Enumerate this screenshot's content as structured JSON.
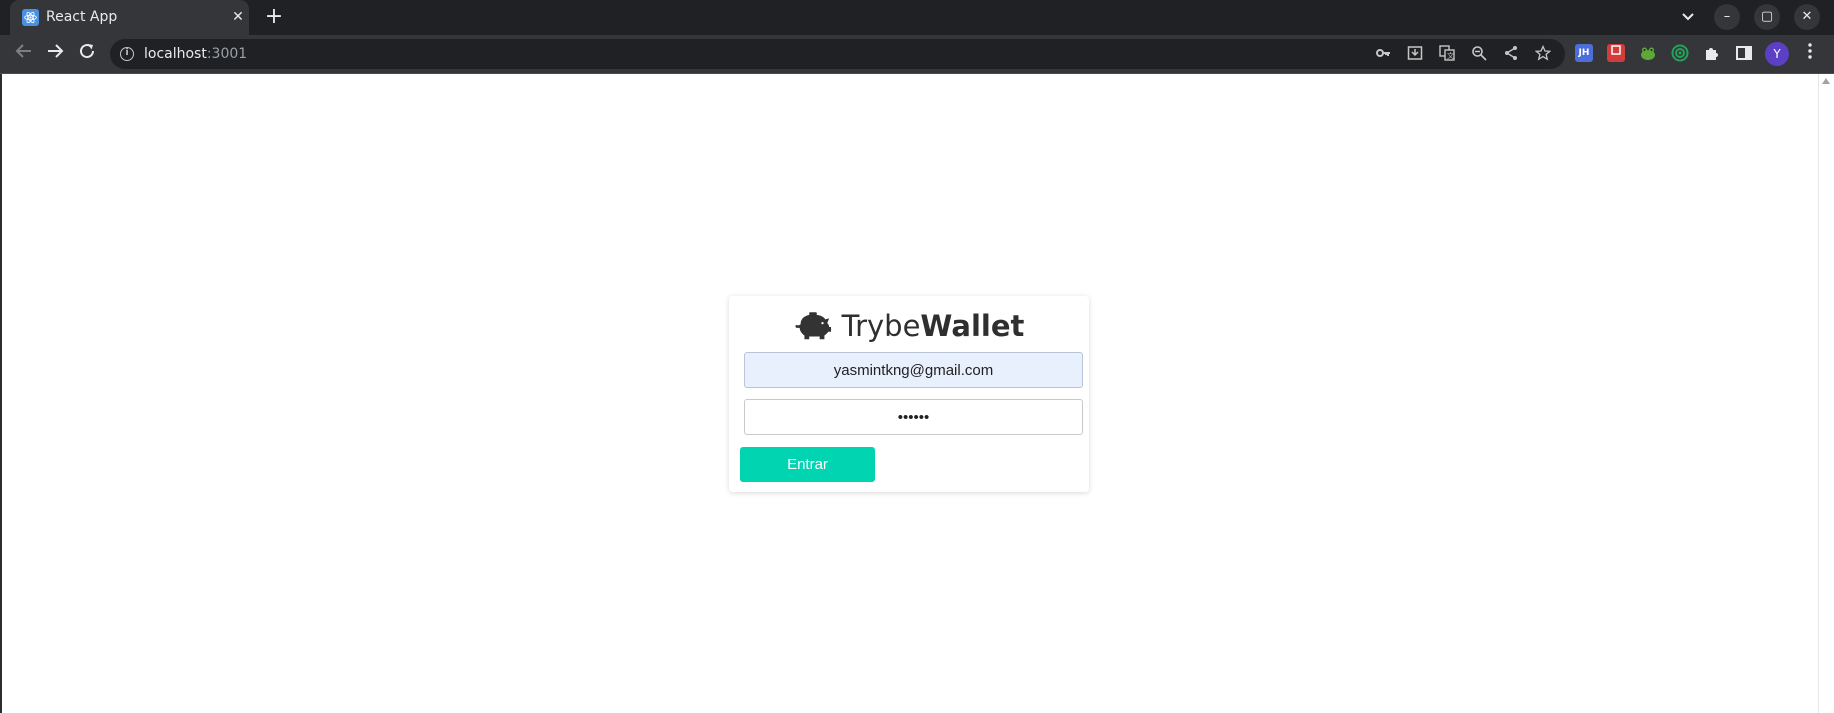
{
  "browser": {
    "tab": {
      "title": "React App",
      "favicon": "react-atom-icon"
    },
    "new_tab_symbol": "+",
    "window_controls": {
      "minimize": "–",
      "maximize": "▢",
      "close": "✕"
    },
    "url": {
      "host": "localhost",
      "port": ":3001"
    },
    "extensions": [
      {
        "name": "jsonhero-icon",
        "label": "JH",
        "color": "#4c6edb"
      },
      {
        "name": "ublock-icon",
        "label": "",
        "color": "#d43b3b"
      },
      {
        "name": "frog-icon",
        "label": "",
        "color": "#5ea83a"
      },
      {
        "name": "target-icon",
        "label": "",
        "color": "#22a35a"
      }
    ],
    "avatar_letter": "Y"
  },
  "login": {
    "brand_light": "Trybe",
    "brand_bold": "Wallet",
    "email_value": "yasmintkng@gmail.com",
    "password_value": "••••••",
    "submit_label": "Entrar",
    "accent_color": "#00d4b0"
  }
}
